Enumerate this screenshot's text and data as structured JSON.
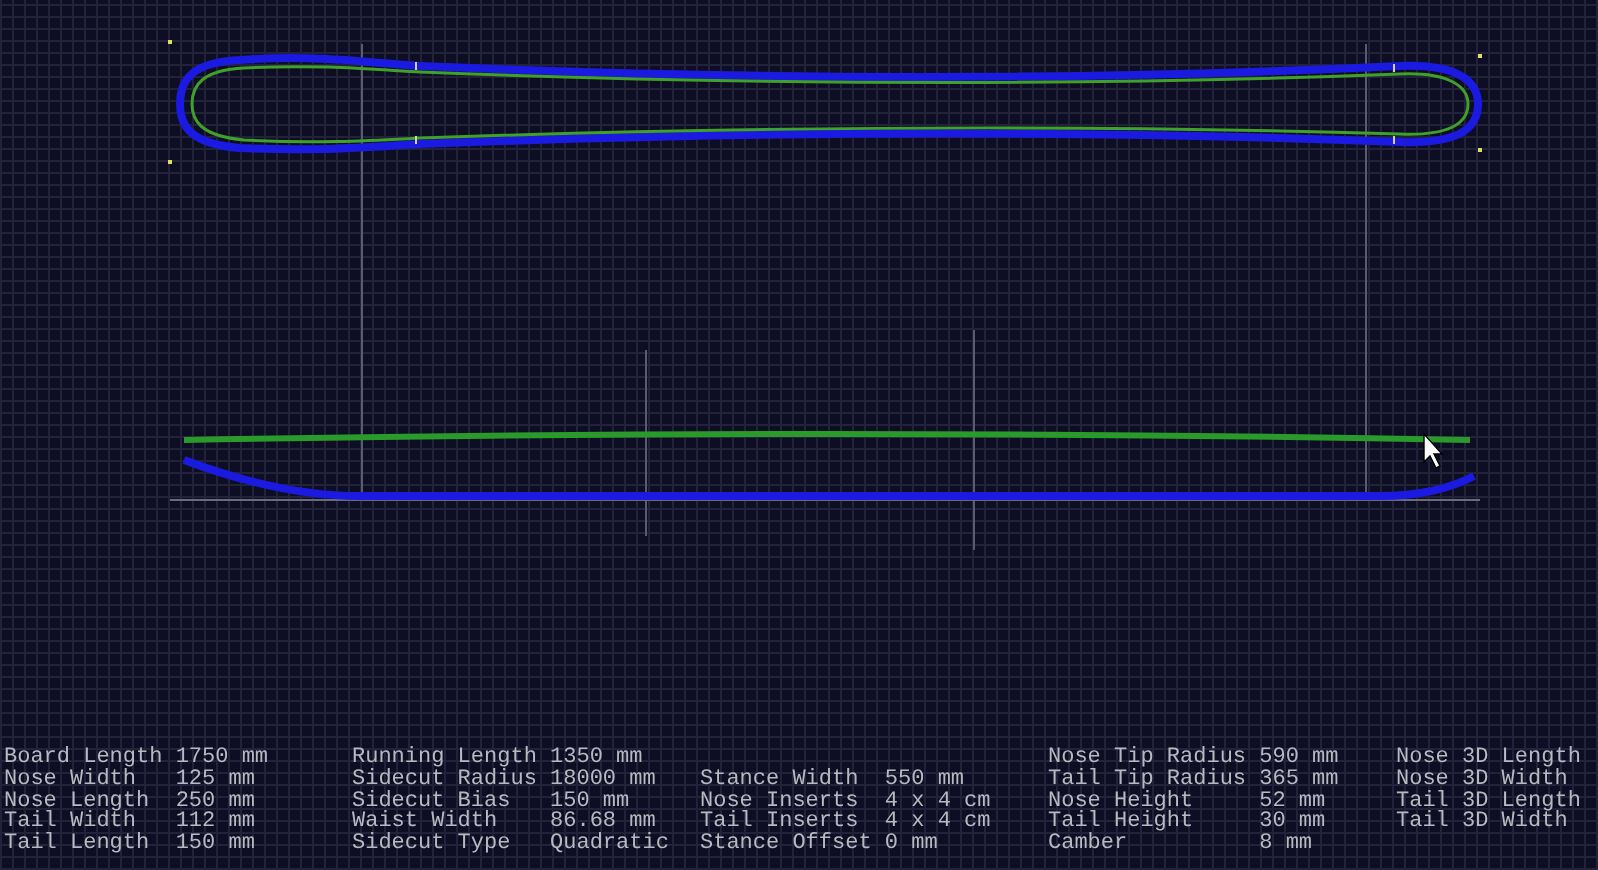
{
  "parameters": {
    "columns": [
      [
        {
          "label": "Board Length",
          "value": "1750 mm"
        },
        {
          "label": "Nose Width",
          "value": "125 mm"
        },
        {
          "label": "Nose Length",
          "value": "250 mm"
        },
        {
          "label": "Tail Width",
          "value": "112 mm"
        },
        {
          "label": "Tail Length",
          "value": "150 mm"
        }
      ],
      [
        {
          "label": "Running Length",
          "value": "1350 mm"
        },
        {
          "label": "Sidecut Radius",
          "value": "18000 mm"
        },
        {
          "label": "Sidecut Bias",
          "value": "150 mm"
        },
        {
          "label": "Waist Width",
          "value": "86.68 mm"
        },
        {
          "label": "Sidecut Type",
          "value": "Quadratic"
        }
      ],
      [
        null,
        {
          "label": "Stance Width",
          "value": "550 mm"
        },
        {
          "label": "Nose Inserts",
          "value": "4 x 4 cm"
        },
        {
          "label": "Tail Inserts",
          "value": "4 x 4 cm"
        },
        {
          "label": "Stance Offset",
          "value": "0 mm"
        }
      ],
      [
        {
          "label": "Nose Tip Radius",
          "value": "590 mm"
        },
        {
          "label": "Tail Tip Radius",
          "value": "365 mm"
        },
        {
          "label": "Nose Height",
          "value": "52 mm"
        },
        {
          "label": "Tail Height",
          "value": "30 mm"
        },
        {
          "label": "Camber",
          "value": "8 mm"
        }
      ],
      [
        {
          "label": "Nose 3D Length"
        },
        {
          "label": "Nose 3D Width"
        },
        {
          "label": "Tail 3D Length"
        },
        {
          "label": "Tail 3D Width"
        }
      ]
    ]
  }
}
